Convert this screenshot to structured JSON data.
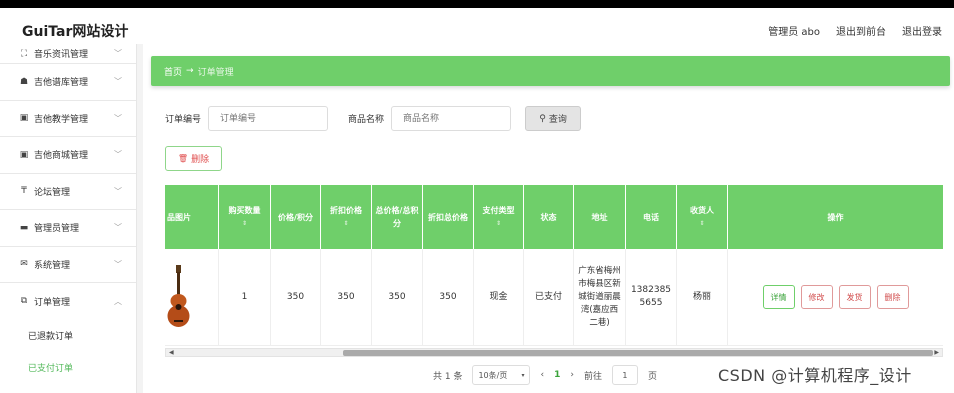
{
  "app": {
    "title": "GuiTar网站设计"
  },
  "header": {
    "user": "管理员 abo",
    "front": "退出到前台",
    "logout": "退出登录"
  },
  "sidebar": {
    "items": [
      {
        "icon": "⛶",
        "label": "音乐资讯管理",
        "chev": "﹀"
      },
      {
        "icon": "☗",
        "label": "吉他谱库管理",
        "chev": "﹀"
      },
      {
        "icon": "▣",
        "label": "吉他教学管理",
        "chev": "﹀"
      },
      {
        "icon": "▣",
        "label": "吉他商城管理",
        "chev": "﹀"
      },
      {
        "icon": "₸",
        "label": "论坛管理",
        "chev": "﹀"
      },
      {
        "icon": "▬",
        "label": "管理员管理",
        "chev": "﹀"
      },
      {
        "icon": "✉",
        "label": "系统管理",
        "chev": "﹀"
      },
      {
        "icon": "⧉",
        "label": "订单管理",
        "chev": "︿"
      }
    ],
    "sub": [
      "已退款订单",
      "已支付订单"
    ]
  },
  "breadcrumb": {
    "home": "首页",
    "arrow": "→",
    "current": "订单管理"
  },
  "search": {
    "order_label": "订单编号",
    "order_placeholder": "订单编号",
    "goods_label": "商品名称",
    "goods_placeholder": "商品名称",
    "btn": "查询",
    "btn_icon": "⚲"
  },
  "del_btn": {
    "icon": "🗑",
    "label": "删除"
  },
  "table": {
    "headers": [
      "品图片",
      "购买数量",
      "价格/积分",
      "折扣价格",
      "总价格/总积分",
      "折扣总价格",
      "支付类型",
      "状态",
      "地址",
      "电话",
      "收货人",
      "操作"
    ],
    "row": {
      "qty": "1",
      "price": "350",
      "disc": "350",
      "total": "350",
      "disc_total": "350",
      "pay": "现金",
      "status": "已支付",
      "addr": "广东省梅州市梅县区新城街道丽晨湾(嘉应西二巷)",
      "phone": "13823855655",
      "receiver": "杨丽"
    },
    "actions": [
      "详情",
      "修改",
      "发货",
      "删除"
    ]
  },
  "pager": {
    "total": "共 1 条",
    "size": "10条/页",
    "prev": "‹",
    "page": "1",
    "next": "›",
    "goto": "前往",
    "goto_val": "1",
    "unit": "页"
  },
  "watermark": "CSDN @计算机程序_设计"
}
